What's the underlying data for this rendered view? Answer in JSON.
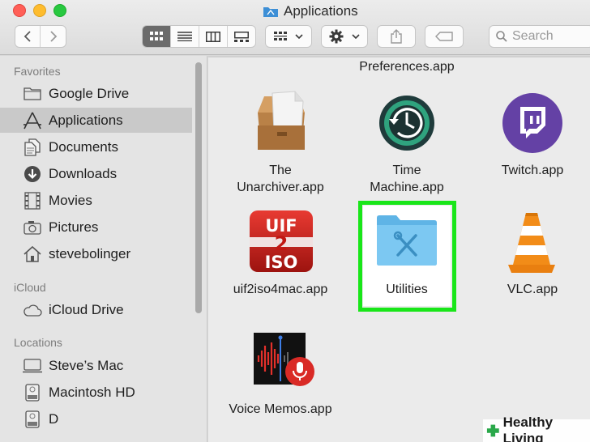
{
  "window": {
    "title": "Applications"
  },
  "toolbar": {
    "back_icon": "chevron-left-icon",
    "forward_icon": "chevron-right-icon",
    "view_modes": [
      "icon-view",
      "list-view",
      "column-view",
      "gallery-view"
    ],
    "search_placeholder": "Search"
  },
  "sidebar": {
    "favorites_label": "Favorites",
    "favorites": [
      {
        "label": "Google Drive",
        "icon": "folder-icon"
      },
      {
        "label": "Applications",
        "icon": "applications-icon",
        "selected": true
      },
      {
        "label": "Documents",
        "icon": "documents-icon"
      },
      {
        "label": "Downloads",
        "icon": "downloads-icon"
      },
      {
        "label": "Movies",
        "icon": "movies-icon"
      },
      {
        "label": "Pictures",
        "icon": "pictures-icon"
      },
      {
        "label": "stevebolinger",
        "icon": "home-icon"
      }
    ],
    "icloud_label": "iCloud",
    "icloud": [
      {
        "label": "iCloud Drive",
        "icon": "cloud-icon"
      }
    ],
    "locations_label": "Locations",
    "locations": [
      {
        "label": "Steve’s Mac",
        "icon": "computer-icon"
      },
      {
        "label": "Macintosh HD",
        "icon": "hard-drive-icon"
      },
      {
        "label": "D",
        "icon": "hard-drive-icon"
      }
    ]
  },
  "content": {
    "partial_top_label": "Preferences.app",
    "apps": [
      {
        "line1": "The",
        "line2": "Unarchiver.app"
      },
      {
        "line1": "Time",
        "line2": "Machine.app"
      },
      {
        "line1": "Twitch.app",
        "line2": ""
      },
      {
        "line1": "uif2iso4mac.app",
        "line2": ""
      },
      {
        "line1": "Utilities",
        "line2": ""
      },
      {
        "line1": "VLC.app",
        "line2": ""
      },
      {
        "line1": "Voice Memos.app",
        "line2": ""
      }
    ],
    "uif_icon_text": [
      "UIF",
      "2",
      "ISO"
    ]
  },
  "watermark": {
    "text": "Healthy Living"
  },
  "colors": {
    "highlight": "#19e619",
    "selection": "#c9c9c9",
    "twitch": "#6441a5",
    "folder": "#6cc3f0"
  }
}
